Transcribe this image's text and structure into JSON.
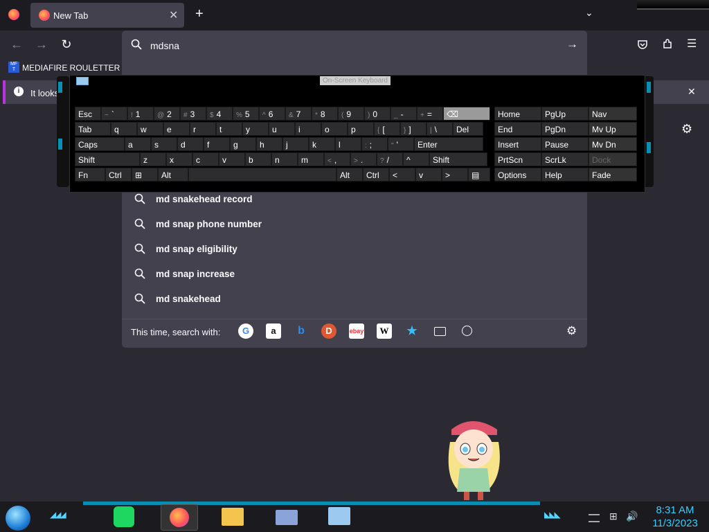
{
  "browser": {
    "tab_title": "New Tab",
    "new_tab_glyph": "+",
    "url_input_value": "mdsna",
    "bookmark_label": "MEDIAFIRE ROULETTER",
    "notification_text": "It looks"
  },
  "suggestions": [
    "md snakehead record",
    "md snap phone number",
    "md snap eligibility",
    "md snap increase",
    "md snakehead"
  ],
  "search_with": {
    "label": "This time, search with:",
    "engines": [
      "google-icon",
      "amazon-icon",
      "bing-icon",
      "duckduckgo-icon",
      "ebay-icon",
      "wikipedia-icon",
      "bookmarks-icon",
      "tabs-icon",
      "history-icon"
    ]
  },
  "keyboard": {
    "title": "On-Screen Keyboard",
    "row1": [
      {
        "main": "Esc"
      },
      {
        "sub": "~",
        "main": "`"
      },
      {
        "sub": "!",
        "main": "1"
      },
      {
        "sub": "@",
        "main": "2"
      },
      {
        "sub": "#",
        "main": "3"
      },
      {
        "sub": "$",
        "main": "4"
      },
      {
        "sub": "%",
        "main": "5"
      },
      {
        "sub": "^",
        "main": "6"
      },
      {
        "sub": "&",
        "main": "7"
      },
      {
        "sub": "*",
        "main": "8"
      },
      {
        "sub": "(",
        "main": "9"
      },
      {
        "sub": ")",
        "main": "0"
      },
      {
        "sub": "_",
        "main": "-"
      },
      {
        "sub": "+",
        "main": "="
      },
      {
        "main": "⌫"
      }
    ],
    "row2": [
      {
        "main": "Tab"
      },
      {
        "main": "q"
      },
      {
        "main": "w"
      },
      {
        "main": "e"
      },
      {
        "main": "r"
      },
      {
        "main": "t"
      },
      {
        "main": "y"
      },
      {
        "main": "u"
      },
      {
        "main": "i"
      },
      {
        "main": "o"
      },
      {
        "main": "p"
      },
      {
        "sub": "{",
        "main": "["
      },
      {
        "sub": "}",
        "main": "]"
      },
      {
        "sub": "|",
        "main": "\\"
      },
      {
        "main": "Del"
      }
    ],
    "row3": [
      {
        "main": "Caps"
      },
      {
        "main": "a"
      },
      {
        "main": "s"
      },
      {
        "main": "d"
      },
      {
        "main": "f"
      },
      {
        "main": "g"
      },
      {
        "main": "h"
      },
      {
        "main": "j"
      },
      {
        "main": "k"
      },
      {
        "main": "l"
      },
      {
        "sub": ":",
        "main": ";"
      },
      {
        "sub": "\"",
        "main": "'"
      },
      {
        "main": "Enter"
      }
    ],
    "row4": [
      {
        "main": "Shift"
      },
      {
        "main": "z"
      },
      {
        "main": "x"
      },
      {
        "main": "c"
      },
      {
        "main": "v"
      },
      {
        "main": "b"
      },
      {
        "main": "n"
      },
      {
        "main": "m"
      },
      {
        "sub": "<",
        "main": ","
      },
      {
        "sub": ">",
        "main": "."
      },
      {
        "sub": "?",
        "main": "/"
      },
      {
        "main": "^"
      },
      {
        "main": "Shift"
      }
    ],
    "row5": [
      {
        "main": "Fn"
      },
      {
        "main": "Ctrl"
      },
      {
        "main": "⊞"
      },
      {
        "main": "Alt"
      },
      {
        "main": ""
      },
      {
        "main": "Alt"
      },
      {
        "main": "Ctrl"
      },
      {
        "main": "<"
      },
      {
        "main": "v"
      },
      {
        "main": ">"
      },
      {
        "main": "▤"
      }
    ],
    "nav_rows": [
      [
        "Home",
        "PgUp",
        "Nav"
      ],
      [
        "End",
        "PgDn",
        "Mv Up"
      ],
      [
        "Insert",
        "Pause",
        "Mv Dn"
      ],
      [
        "PrtScn",
        "ScrLk",
        "Dock"
      ],
      [
        "Options",
        "Help",
        "Fade"
      ]
    ]
  },
  "taskbar": {
    "time": "8:31 AM",
    "date": "11/3/2023"
  },
  "colors": {
    "accent": "#33d0ff",
    "tab_bg": "#42414d",
    "notif_bar": "#b833e1"
  }
}
